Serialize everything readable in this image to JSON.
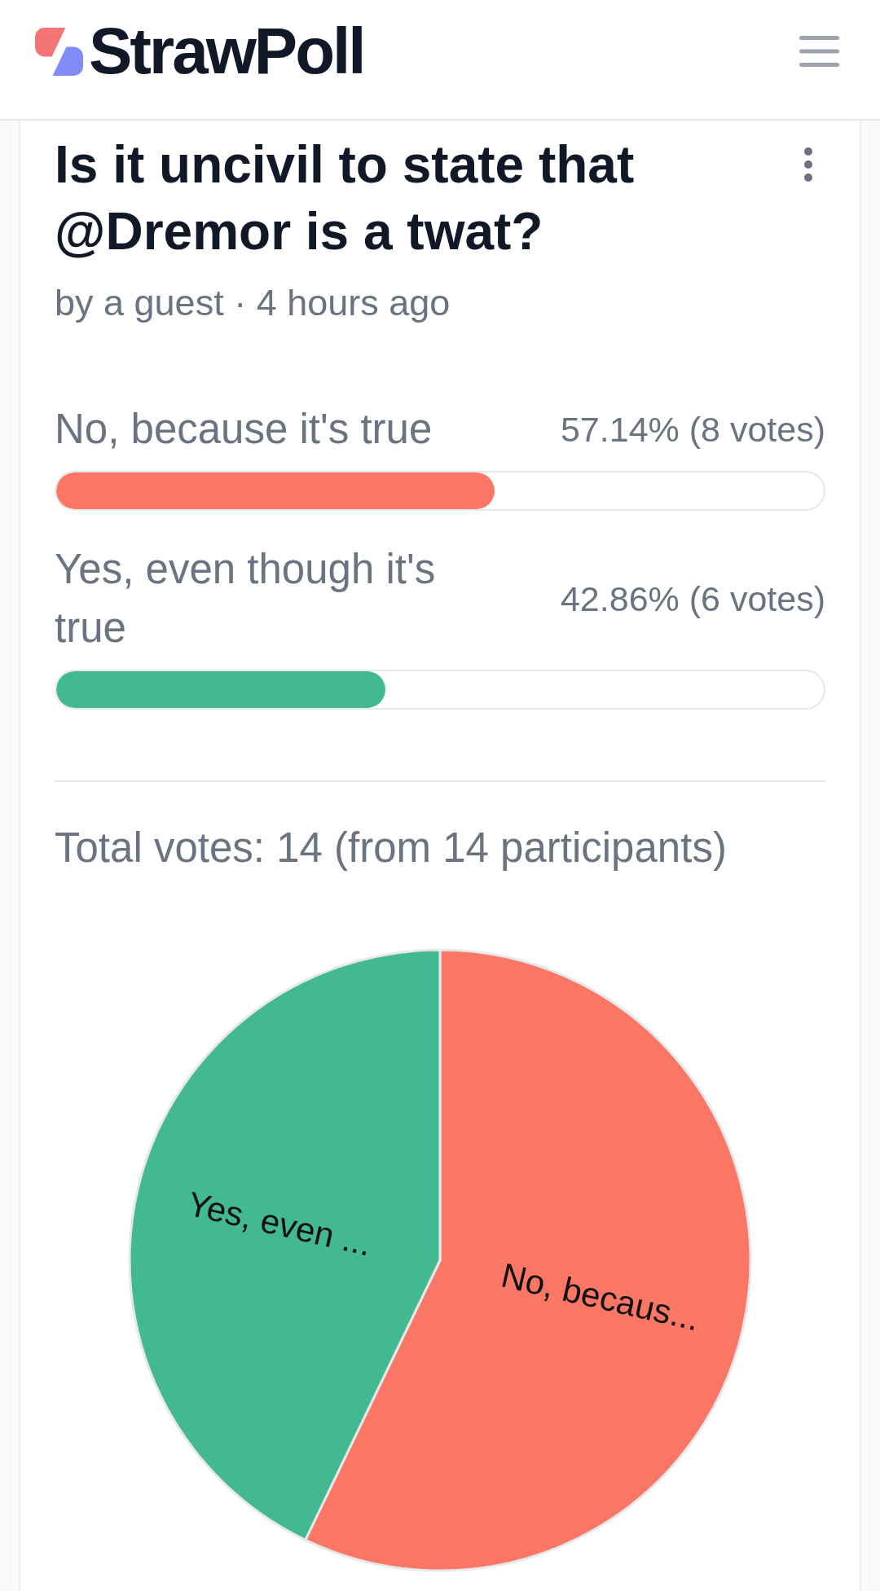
{
  "header": {
    "logo": "StrawPoll"
  },
  "poll": {
    "title": "Is it uncivil to state that @Dremor is a twat?",
    "byline": "by a guest · 4 hours ago",
    "options": [
      {
        "label": "No, because it's true",
        "result": "57.14% (8 votes)",
        "level": 0.5714,
        "color": "#fa7665"
      },
      {
        "label": "Yes, even though it's true",
        "result": "42.86% (6 votes)",
        "level": 0.4286,
        "color": "#42b991"
      }
    ],
    "total": "Total votes: 14 (from 14 participants)",
    "chart_data": {
      "type": "pie",
      "categories": [
        "No, becaus...",
        "Yes, even ..."
      ],
      "values": [
        57.14,
        42.86
      ]
    }
  }
}
